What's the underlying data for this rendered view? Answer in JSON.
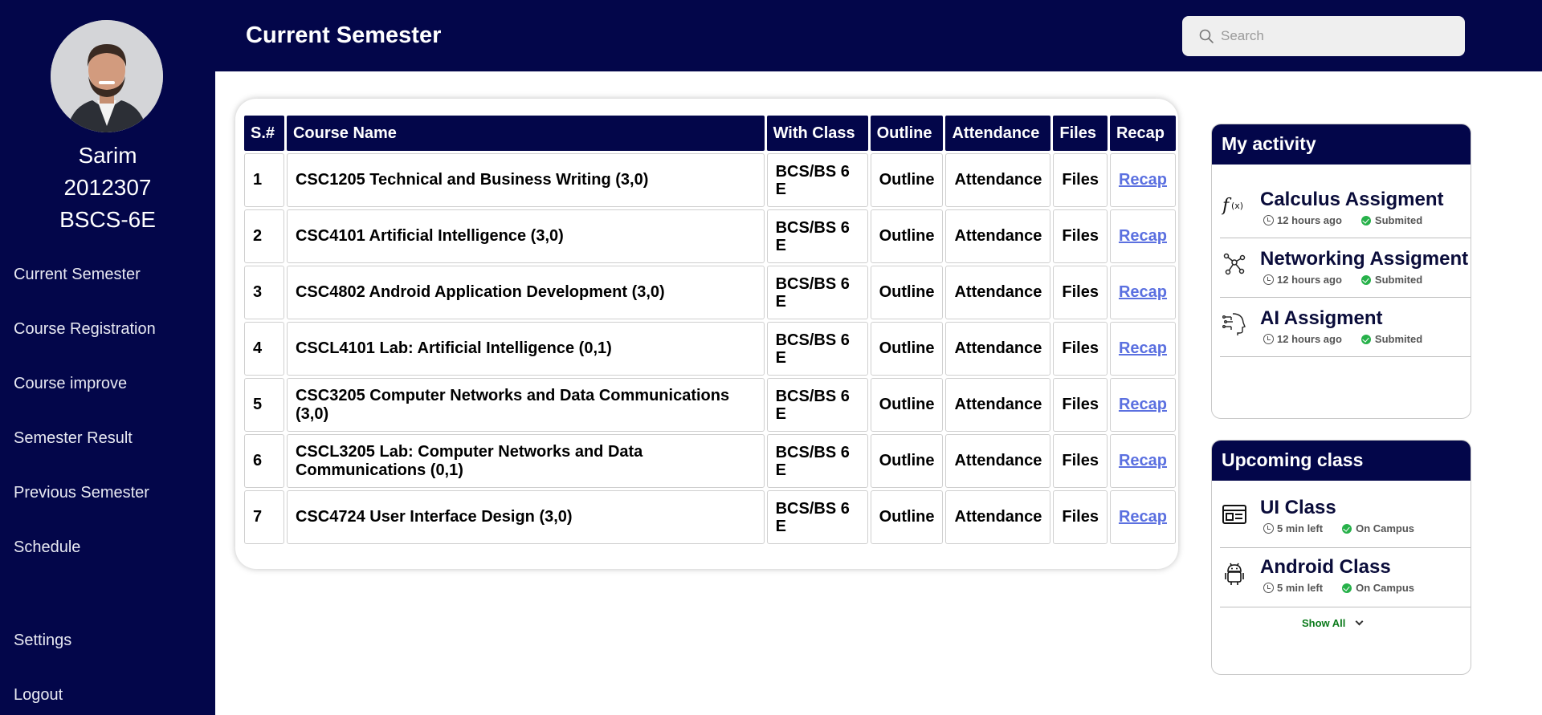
{
  "profile": {
    "name": "Sarim",
    "id": "2012307",
    "program": "BSCS-6E"
  },
  "sidebar": {
    "items": [
      {
        "label": "Current Semester"
      },
      {
        "label": "Course Registration"
      },
      {
        "label": "Course improve"
      },
      {
        "label": "Semester Result"
      },
      {
        "label": "Previous Semester"
      },
      {
        "label": "Schedule"
      },
      {
        "label": "Settings"
      },
      {
        "label": "Logout"
      }
    ]
  },
  "header": {
    "title": "Current Semester",
    "search_placeholder": "Search"
  },
  "table": {
    "headers": [
      "S.#",
      "Course Name",
      "With Class",
      "Outline",
      "Attendance",
      "Files",
      "Recap"
    ],
    "rows": [
      {
        "sn": "1",
        "course": "CSC1205 Technical and Business Writing (3,0)",
        "class": "BCS/BS 6 E",
        "outline": "Outline",
        "attendance": "Attendance",
        "files": "Files",
        "recap": "Recap"
      },
      {
        "sn": "2",
        "course": "CSC4101 Artificial Intelligence (3,0)",
        "class": "BCS/BS 6 E",
        "outline": "Outline",
        "attendance": "Attendance",
        "files": "Files",
        "recap": "Recap"
      },
      {
        "sn": "3",
        "course": "CSC4802 Android Application Development (3,0)",
        "class": "BCS/BS 6 E",
        "outline": "Outline",
        "attendance": "Attendance",
        "files": "Files",
        "recap": "Recap"
      },
      {
        "sn": "4",
        "course": "CSCL4101 Lab: Artificial Intelligence (0,1)",
        "class": "BCS/BS 6 E",
        "outline": "Outline",
        "attendance": "Attendance",
        "files": "Files",
        "recap": "Recap"
      },
      {
        "sn": "5",
        "course": "CSC3205 Computer Networks and Data Communications (3,0)",
        "class": "BCS/BS 6 E",
        "outline": "Outline",
        "attendance": "Attendance",
        "files": "Files",
        "recap": "Recap"
      },
      {
        "sn": "6",
        "course": "CSCL3205 Lab: Computer Networks and Data Communications (0,1)",
        "class": "BCS/BS 6 E",
        "outline": "Outline",
        "attendance": "Attendance",
        "files": "Files",
        "recap": "Recap"
      },
      {
        "sn": "7",
        "course": "CSC4724 User Interface Design (3,0)",
        "class": "BCS/BS 6 E",
        "outline": "Outline",
        "attendance": "Attendance",
        "files": "Files",
        "recap": "Recap"
      }
    ]
  },
  "activity": {
    "title": "My activity",
    "items": [
      {
        "title": "Calculus Assigment",
        "time": "12 hours ago",
        "status": "Submited",
        "icon": "function-icon"
      },
      {
        "title": "Networking Assigment",
        "time": "12 hours ago",
        "status": "Submited",
        "icon": "network-icon"
      },
      {
        "title": "AI Assigment",
        "time": "12 hours ago",
        "status": "Submited",
        "icon": "ai-brain-icon"
      }
    ]
  },
  "upcoming": {
    "title": "Upcoming class",
    "items": [
      {
        "title": "UI Class",
        "time": "5 min left",
        "status": "On Campus",
        "icon": "layout-icon"
      },
      {
        "title": "Android Class",
        "time": "5 min left",
        "status": "On Campus",
        "icon": "android-icon"
      }
    ],
    "show_all": "Show All"
  },
  "colors": {
    "navy": "#03064a",
    "link": "#5b70e0",
    "success": "#27b14a"
  }
}
